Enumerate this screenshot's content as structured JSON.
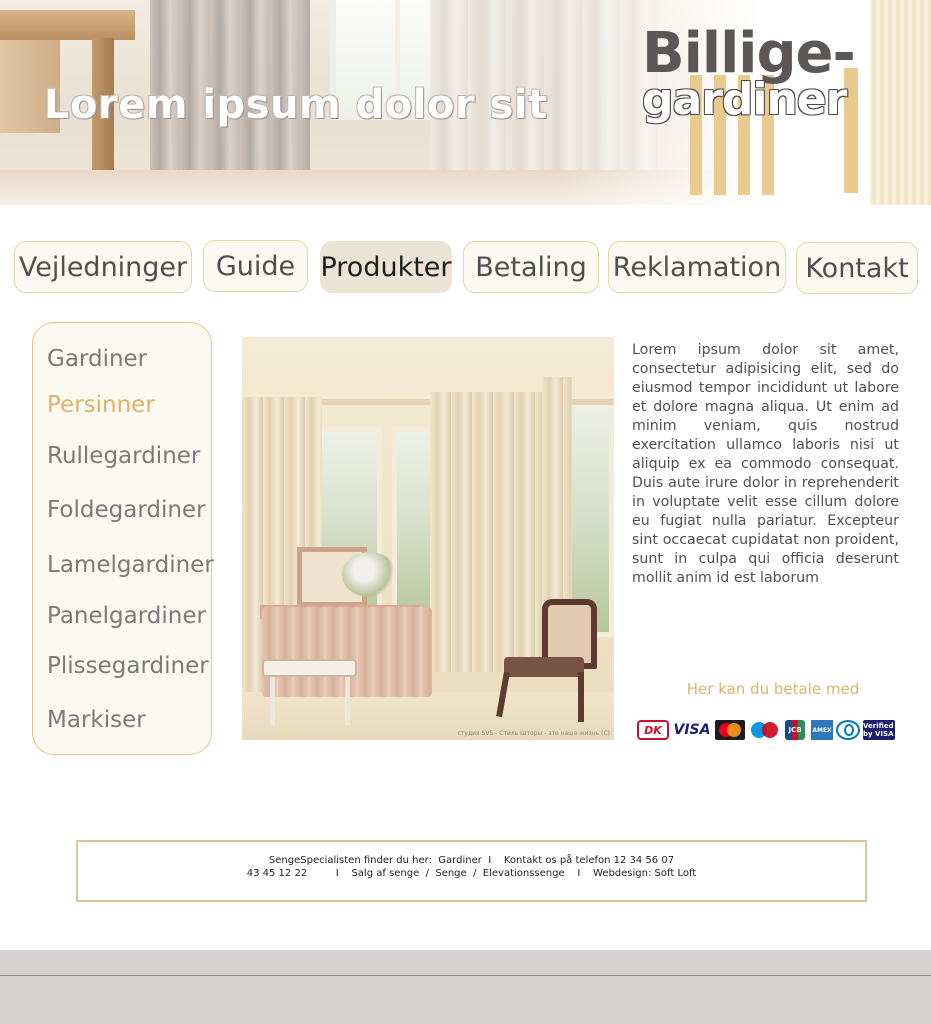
{
  "header": {
    "title": "Lorem ipsum dolor sit",
    "logo": {
      "line1": "Billige-",
      "line2": "gardiner"
    }
  },
  "nav": {
    "tabs": [
      {
        "label": "Vejledninger"
      },
      {
        "label": "Guide"
      },
      {
        "label": "Produkter",
        "active": true
      },
      {
        "label": "Betaling"
      },
      {
        "label": "Reklamation"
      },
      {
        "label": "Kontakt"
      }
    ]
  },
  "sidebar": {
    "items": [
      {
        "label": "Gardiner"
      },
      {
        "label": "Persinner",
        "active": true
      },
      {
        "label": "Rullegardiner"
      },
      {
        "label": "Foldegardiner"
      },
      {
        "label": "Lamelgardiner"
      },
      {
        "label": "Panelgardiner"
      },
      {
        "label": "Plissegardiner"
      },
      {
        "label": "Markiser"
      }
    ]
  },
  "main": {
    "photo_credit": "студия SVS - Стиль  Шторы - это наша жизнь (C)",
    "body_text": "Lorem ipsum dolor sit amet, consectetur adipisicing elit, sed do eiusmod tempor incididunt ut labore et dolore magna aliqua. Ut enim ad minim veniam, quis nostrud exercitation ullamco laboris nisi ut aliquip ex ea commodo consequat. Duis aute irure dolor in reprehenderit in voluptate velit esse cillum dolore eu fugiat nulla pariatur. Excepteur sint occaecat cupidatat non proident, sunt in culpa qui officia deserunt mollit anim id est laborum",
    "payment_label": "Her kan du betale med",
    "payment_icons": {
      "dankort": "DK",
      "visa": "VISA",
      "jcb": "JCB",
      "amex": "AMEX",
      "verified_by_visa": "Verified by VISA"
    }
  },
  "footer": {
    "line1": "SengeSpecialisten finder du her:  Gardiner  I    Kontakt os på telefon 12 34 56 07",
    "line2": "43 45 12 22         I    Salg af senge  /  Senge  /  Elevationssenge    I    Webdesign: Soft Loft"
  },
  "colors": {
    "accent_gold": "#e1b06a",
    "border_gold": "#e1c78e",
    "nav_border": "#dfd8a9",
    "nav_active_bg": "#ebe3d3",
    "text_gray": "#505050",
    "bottom_band": "#d6d2d2"
  }
}
